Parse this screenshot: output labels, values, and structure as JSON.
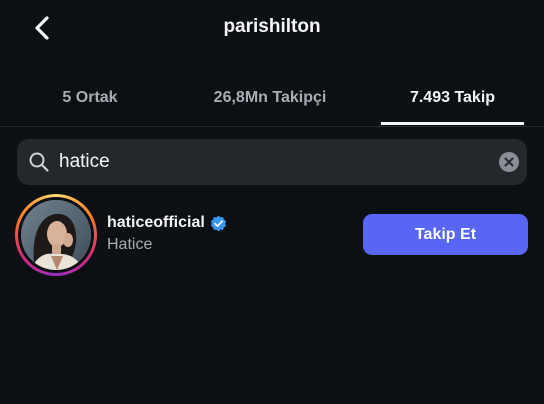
{
  "header": {
    "title": "parishilton",
    "back_icon": "chevron-left-icon"
  },
  "tabs": [
    {
      "label": "5 Ortak",
      "active": false
    },
    {
      "label": "26,8Mn Takipçi",
      "active": false
    },
    {
      "label": "7.493 Takip",
      "active": true
    }
  ],
  "search": {
    "value": "hatice",
    "icon": "search-icon",
    "clear_icon": "clear-icon"
  },
  "results": [
    {
      "username": "haticeofficial",
      "verified": true,
      "full_name": "Hatice",
      "follow_label": "Takip Et"
    }
  ],
  "colors": {
    "background": "#0c1014",
    "search_bg": "#24282d",
    "follow_button": "#5865f5",
    "verified_badge": "#3897f0",
    "secondary_text": "#a8adb3"
  }
}
